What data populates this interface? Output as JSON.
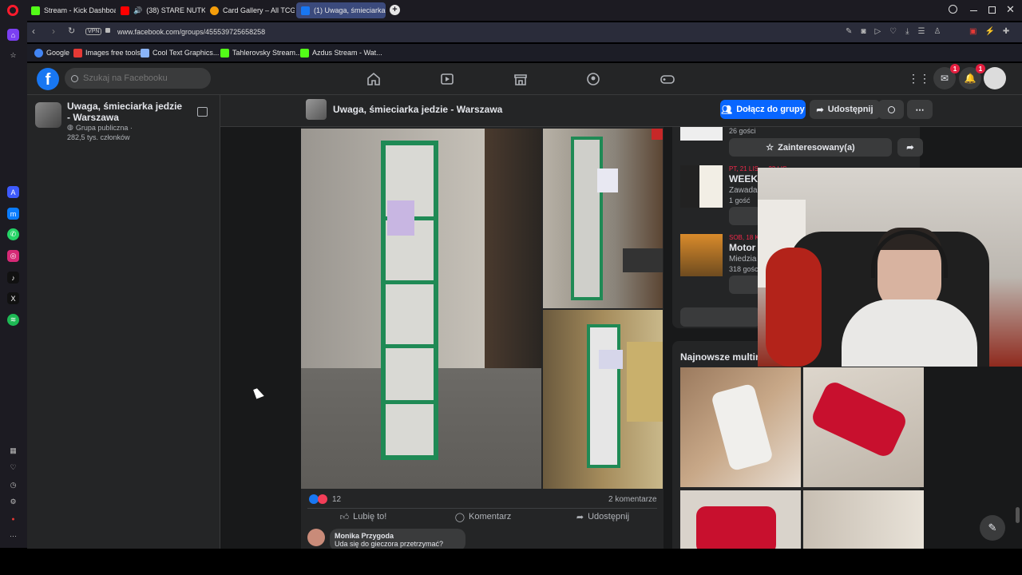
{
  "browser": {
    "tabs": [
      {
        "label": "Stream - Kick Dashboard",
        "favicon_color": "#53fc18"
      },
      {
        "label": "(38) STARE NUTKI W R",
        "favicon_color": "#ff0000"
      },
      {
        "label": "Card Gallery – All TCG Set",
        "favicon_color": "#f59e0b"
      },
      {
        "label": "(1) Uwaga, śmieciarka jedz",
        "favicon_color": "#1877f2"
      }
    ],
    "url": "www.facebook.com/groups/455539725658258",
    "vpn_label": "VPN",
    "bookmarks": [
      {
        "label": "Google",
        "color": "#4285f4"
      },
      {
        "label": "Images free tools",
        "color": "#e53935"
      },
      {
        "label": "Cool Text Graphics...",
        "color": "#8ab4f8"
      },
      {
        "label": "Tahlerovsky Stream...",
        "color": "#53fc18"
      },
      {
        "label": "Azdus Stream - Wat...",
        "color": "#53fc18"
      }
    ],
    "sidebar_icons": [
      "opera-logo",
      "home-icon",
      "star-icon",
      "aria-icon",
      "messenger-icon",
      "whatsapp-icon",
      "instagram-icon",
      "tiktok-icon",
      "x-icon",
      "spotify-icon",
      "apps-icon",
      "heart-icon",
      "history-icon",
      "settings-icon",
      "more-icon"
    ]
  },
  "facebook": {
    "search_placeholder": "Szukaj na Facebooku",
    "notifications": {
      "messenger": "1",
      "bell": "1"
    }
  },
  "group": {
    "name": "Uwaga, śmieciarka jedzie - Warszawa",
    "privacy": "Grupa publiczna ·",
    "members": "282,5 tys. członków",
    "header_title": "Uwaga, śmieciarka jedzie - Warszawa",
    "join_label": "Dołącz do grupy",
    "share_label": "Udostępnij"
  },
  "post": {
    "reaction_count": "12",
    "comments_count": "2 komentarze",
    "like_label": "Lubię to!",
    "comment_label": "Komentarz",
    "share_label": "Udostępnij",
    "first_comment": {
      "author": "Monika Przygoda",
      "text": "Uda się do gieczora przetrzymać?"
    }
  },
  "events": {
    "item1_guests": "26 gości",
    "interested_label": "Zainteresowany(a)",
    "item2_date": "PT, 21 LIS — 23 LIS",
    "item2_title": "WEEKE",
    "item2_place": "Zawada,",
    "item2_guests": "1 gość",
    "item3_date": "SOB, 18 K",
    "item3_title": "Motor",
    "item3_place": "Miedzia",
    "item3_guests": "318 gości"
  },
  "media": {
    "heading": "Najnowsze multime"
  }
}
